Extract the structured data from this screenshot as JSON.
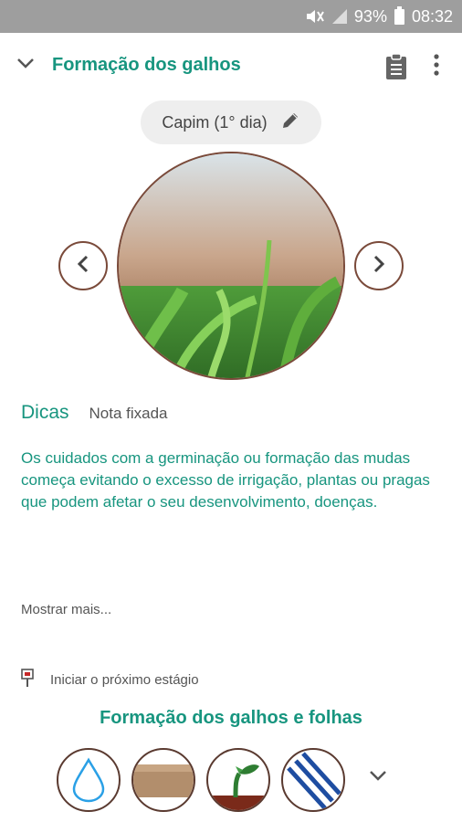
{
  "status_bar": {
    "battery_percent": "93%",
    "time": "08:32",
    "icons": [
      "mute-icon",
      "signal-icon",
      "battery-icon"
    ]
  },
  "header": {
    "title": "Formação dos galhos",
    "icons": [
      "chevron-down-icon",
      "clipboard-icon",
      "more-vert-icon"
    ]
  },
  "stage_chip": {
    "label": "Capim (1° dia)",
    "icon": "pencil-icon"
  },
  "tips": {
    "tabs": [
      "Dicas",
      "Nota fixada"
    ],
    "text": "Os cuidados com a germinação ou formação das mudas começa evitando o excesso de irrigação, plantas ou pragas que podem afetar o seu desenvolvimento, doenças.",
    "show_more": "Mostrar mais..."
  },
  "next_stage": {
    "label": "Iniciar o próximo estágio",
    "icon": "flag-icon"
  },
  "stages": {
    "title": "Formação dos galhos e folhas",
    "icons": [
      "water-drop-icon",
      "soil-icon",
      "sprout-icon",
      "stripes-icon"
    ]
  },
  "colors": {
    "accent": "#17957f",
    "border": "#7a4a3a",
    "status_bar": "#9e9e9e"
  }
}
